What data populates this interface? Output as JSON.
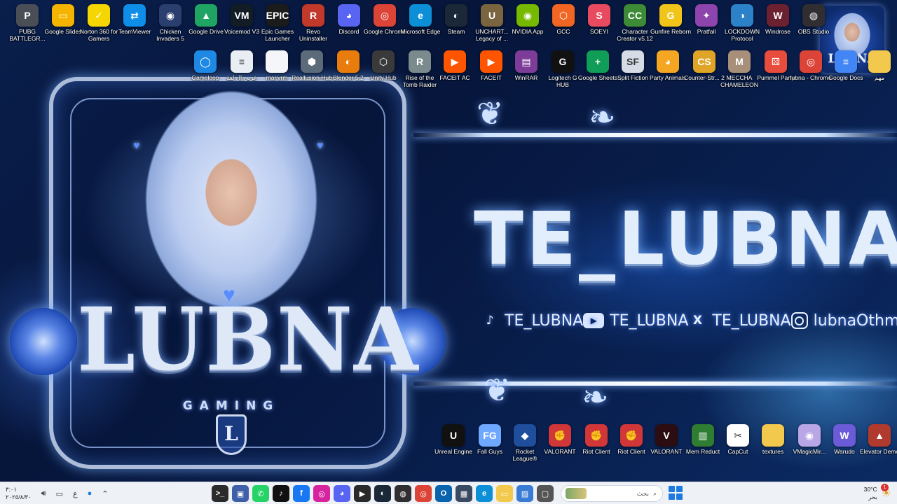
{
  "wallpaper": {
    "logo_text": "LUBNA",
    "logo_sub": "GAMING",
    "emblem_letter": "L",
    "brand_title": "TE_LUBNA",
    "corner_badge": "LUBNA",
    "socials": [
      {
        "icon": "tiktok-icon",
        "glyph": "♪",
        "handle": "TE_LUBNA"
      },
      {
        "icon": "youtube-icon",
        "glyph": "▶",
        "handle": "TE_LUBNA"
      },
      {
        "icon": "x-icon",
        "glyph": "X",
        "handle": "TE_LUBNA"
      },
      {
        "icon": "instagram-icon",
        "glyph": "",
        "handle": "lubnaOthman"
      }
    ]
  },
  "desktop_icons": [
    {
      "label": "PUBG BATTLEGR...",
      "icon": "pubg-icon",
      "color": "#4a4f57",
      "glyph": "P"
    },
    {
      "label": "Google Slides",
      "icon": "google-slides-icon",
      "color": "#f4b400",
      "glyph": "▭"
    },
    {
      "label": "Norton 360 for Gamers",
      "icon": "norton-icon",
      "color": "#f5d600",
      "glyph": "✓"
    },
    {
      "label": "TeamViewer",
      "icon": "teamviewer-icon",
      "color": "#0e8ee9",
      "glyph": "⇄"
    },
    {
      "label": "Chicken Invaders 5",
      "icon": "chicken-invaders-icon",
      "color": "#2a3f6e",
      "glyph": "◉"
    },
    {
      "label": "Google Drive",
      "icon": "google-drive-icon",
      "color": "#1fa463",
      "glyph": "▲"
    },
    {
      "label": "Voicemod V3",
      "icon": "voicemod-icon",
      "color": "#111c24",
      "glyph": "VM"
    },
    {
      "label": "Epic Games Launcher",
      "icon": "epic-games-icon",
      "color": "#1b1b1b",
      "glyph": "EPIC"
    },
    {
      "label": "Revo Uninstaller",
      "icon": "revo-uninstaller-icon",
      "color": "#c0392b",
      "glyph": "R"
    },
    {
      "label": "Discord",
      "icon": "discord-icon",
      "color": "#5865f2",
      "glyph": "◕"
    },
    {
      "label": "Google Chrome",
      "icon": "chrome-icon",
      "color": "#db4437",
      "glyph": "◎"
    },
    {
      "label": "Microsoft Edge",
      "icon": "edge-icon",
      "color": "#0c8fd6",
      "glyph": "e"
    },
    {
      "label": "Steam",
      "icon": "steam-icon",
      "color": "#1b2838",
      "glyph": "◐"
    },
    {
      "label": "UNCHART... Legacy of ...",
      "icon": "uncharted-icon",
      "color": "#7a6540",
      "glyph": "U"
    },
    {
      "label": "NVIDIA App",
      "icon": "nvidia-icon",
      "color": "#76b900",
      "glyph": "◉"
    },
    {
      "label": "GCC",
      "icon": "gcc-icon",
      "color": "#f26522",
      "glyph": "⬡"
    },
    {
      "label": "SOEYI",
      "icon": "soeyi-icon",
      "color": "#e84a5f",
      "glyph": "S"
    },
    {
      "label": "Character Creator v5.12",
      "icon": "character-creator-icon",
      "color": "#3d8b37",
      "glyph": "CC"
    },
    {
      "label": "Gunfire Reborn",
      "icon": "gunfire-reborn-icon",
      "color": "#f0c419",
      "glyph": "G"
    },
    {
      "label": "Pratfall",
      "icon": "pratfall-icon",
      "color": "#8e44ad",
      "glyph": "✦"
    },
    {
      "label": "LOCKDOWN Protocol",
      "icon": "lockdown-protocol-icon",
      "color": "#2c82c9",
      "glyph": "◑"
    },
    {
      "label": "Windrose",
      "icon": "windrose-icon",
      "color": "#6c2130",
      "glyph": "W"
    },
    {
      "label": "OBS Studio",
      "icon": "obs-icon",
      "color": "#302e31",
      "glyph": "◍"
    },
    {
      "label": "Gameloop",
      "icon": "gameloop-icon",
      "color": "#1e88e5",
      "glyph": "◯"
    },
    {
      "label": "عربي ال لغة",
      "icon": "text-file-icon",
      "color": "#e9eef5",
      "glyph": "≡"
    },
    {
      "label": "mar.vrm",
      "icon": "file-icon",
      "color": "#f4f6f9",
      "glyph": ""
    },
    {
      "label": "Reallusion Hub",
      "icon": "reallusion-hub-icon",
      "color": "#5c6b7a",
      "glyph": "⬢"
    },
    {
      "label": "Blender 5.2",
      "icon": "blender-icon",
      "color": "#e87d0d",
      "glyph": "◐"
    },
    {
      "label": "Unity Hub",
      "icon": "unity-hub-icon",
      "color": "#3a3a3a",
      "glyph": "⬡"
    },
    {
      "label": "Rise of the Tomb Raider",
      "icon": "tomb-raider-icon",
      "color": "#7b8a8c",
      "glyph": "R"
    },
    {
      "label": "FACEIT AC",
      "icon": "faceit-ac-icon",
      "color": "#ff5500",
      "glyph": "▶"
    },
    {
      "label": "FACEIT",
      "icon": "faceit-icon",
      "color": "#ff5500",
      "glyph": "▶"
    },
    {
      "label": "WinRAR",
      "icon": "winrar-icon",
      "color": "#7d3c98",
      "glyph": "▤"
    },
    {
      "label": "Logitech G HUB",
      "icon": "logitech-ghub-icon",
      "color": "#111111",
      "glyph": "G"
    },
    {
      "label": "Google Sheets",
      "icon": "google-sheets-icon",
      "color": "#0f9d58",
      "glyph": "+"
    },
    {
      "label": "Split Fiction",
      "icon": "split-fiction-icon",
      "color": "#d6dce6",
      "glyph": "SF"
    },
    {
      "label": "Party Animals",
      "icon": "party-animals-icon",
      "color": "#f5a623",
      "glyph": "◕"
    },
    {
      "label": "Counter-Str... 2",
      "icon": "counter-strike-icon",
      "color": "#e0a526",
      "glyph": "CS"
    },
    {
      "label": "MECCHA CHAMELEON",
      "icon": "meccha-chameleon-icon",
      "color": "#a88f7a",
      "glyph": "M"
    },
    {
      "label": "Pummel Party",
      "icon": "pummel-party-icon",
      "color": "#e74c3c",
      "glyph": "⚄"
    },
    {
      "label": "lubna - Chrome",
      "icon": "chrome-icon",
      "color": "#db4437",
      "glyph": "◎"
    },
    {
      "label": "Google Docs",
      "icon": "google-docs-icon",
      "color": "#4285f4",
      "glyph": "≡"
    },
    {
      "label": "مهم",
      "icon": "folder-icon",
      "color": "#f2c94c",
      "glyph": ""
    },
    {
      "label": "Unreal Engine",
      "icon": "unreal-engine-icon",
      "color": "#111111",
      "glyph": "U"
    },
    {
      "label": "Fall Guys",
      "icon": "fall-guys-icon",
      "color": "#6fa8ff",
      "glyph": "FG"
    },
    {
      "label": "Rocket League®",
      "icon": "rocket-league-icon",
      "color": "#1f4e9c",
      "glyph": "◆"
    },
    {
      "label": "VALORANT",
      "icon": "valorant-riot-icon",
      "color": "#d13639",
      "glyph": "✊"
    },
    {
      "label": "Riot Client",
      "icon": "riot-client-icon",
      "color": "#d13639",
      "glyph": "✊"
    },
    {
      "label": "Riot Client",
      "icon": "riot-client-icon",
      "color": "#d13639",
      "glyph": "✊"
    },
    {
      "label": "VALORANT",
      "icon": "valorant-icon",
      "color": "#2b0d12",
      "glyph": "V"
    },
    {
      "label": "Mem Reduct",
      "icon": "mem-reduct-icon",
      "color": "#2e7d32",
      "glyph": "▥"
    },
    {
      "label": "CapCut",
      "icon": "capcut-icon",
      "color": "#ffffff",
      "glyph": "✂"
    },
    {
      "label": "textures",
      "icon": "folder-icon",
      "color": "#f2c94c",
      "glyph": ""
    },
    {
      "label": "VMagicMir...",
      "icon": "vmagicmirror-icon",
      "color": "#b9a6e6",
      "glyph": "◉"
    },
    {
      "label": "Warudo",
      "icon": "warudo-icon",
      "color": "#6b5bd6",
      "glyph": "W"
    },
    {
      "label": "Elevator Demo",
      "icon": "elevator-demo-icon",
      "color": "#b03a2e",
      "glyph": "▲"
    }
  ],
  "taskbar": {
    "clock_time": "٣:٠١",
    "clock_date": "٢٠٢٥/٨/٣٠",
    "language": "ع",
    "search_placeholder": "بحث",
    "weather_temp": "30°C",
    "weather_desc": "بحر",
    "notification_count": "1",
    "apps": [
      {
        "icon": "terminal-icon",
        "color": "#2b2b2b",
        "glyph": ">_"
      },
      {
        "icon": "app-icon",
        "color": "#3f5fa8",
        "glyph": "▣"
      },
      {
        "icon": "whatsapp-icon",
        "color": "#25d366",
        "glyph": "✆"
      },
      {
        "icon": "tiktok-icon",
        "color": "#111111",
        "glyph": "♪"
      },
      {
        "icon": "facebook-icon",
        "color": "#1877f2",
        "glyph": "f"
      },
      {
        "icon": "instagram-icon",
        "color": "#d6249f",
        "glyph": "◎"
      },
      {
        "icon": "discord-icon",
        "color": "#5865f2",
        "glyph": "◕"
      },
      {
        "icon": "faceit-icon",
        "color": "#2a2a2a",
        "glyph": "▶"
      },
      {
        "icon": "steam-icon",
        "color": "#1b2838",
        "glyph": "◐"
      },
      {
        "icon": "obs-icon",
        "color": "#302e31",
        "glyph": "◍"
      },
      {
        "icon": "chrome-icon",
        "color": "#db4437",
        "glyph": "◎"
      },
      {
        "icon": "outlook-icon",
        "color": "#0a64ad",
        "glyph": "O"
      },
      {
        "icon": "calculator-icon",
        "color": "#3b4a63",
        "glyph": "▦"
      },
      {
        "icon": "edge-icon",
        "color": "#0c8fd6",
        "glyph": "e"
      },
      {
        "icon": "file-explorer-icon",
        "color": "#f2c94c",
        "glyph": "▭"
      },
      {
        "icon": "photos-icon",
        "color": "#3a7bd5",
        "glyph": "▨"
      },
      {
        "icon": "task-view-icon",
        "color": "#555555",
        "glyph": "▢"
      }
    ]
  }
}
